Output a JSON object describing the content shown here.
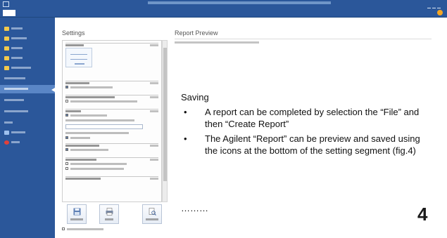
{
  "window": {
    "title": ""
  },
  "ribbon": {
    "tabs": [
      "",
      "",
      ""
    ]
  },
  "sidebar": {
    "items": [
      "",
      "",
      "",
      "",
      "",
      "",
      "",
      "",
      "",
      "",
      "",
      "",
      ""
    ],
    "active_index": 5
  },
  "settings": {
    "heading": "Settings",
    "sections": [
      "",
      "",
      "",
      "",
      "",
      "",
      "",
      ""
    ],
    "buttons": {
      "save": "",
      "print": "",
      "preview": ""
    },
    "after_saving_option": ""
  },
  "preview": {
    "heading": "Report Preview",
    "note": ""
  },
  "slide": {
    "title": "Saving",
    "bullets": [
      "A report can be completed by selection the “File” and then “Create Report”",
      "The Agilent “Report” can be preview and saved using the icons at the bottom of the setting segment (fig.4)"
    ],
    "bullet_glyph": "•",
    "ellipsis": "………",
    "page_number": "4"
  },
  "colors": {
    "ribbon_blue": "#2b579a",
    "sidebar_active": "#5a86c6",
    "accent_yellow": "#f2c94c",
    "exit_red": "#e0403a"
  }
}
